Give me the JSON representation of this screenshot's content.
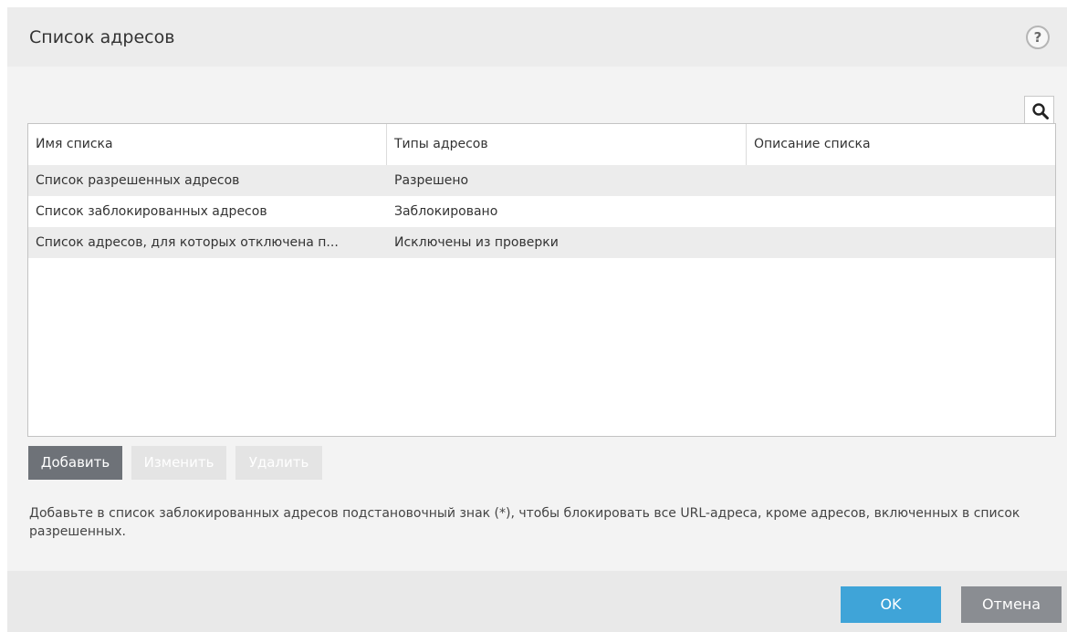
{
  "dialog": {
    "title": "Список адресов",
    "help_symbol": "?"
  },
  "table": {
    "columns": [
      "Имя списка",
      "Типы адресов",
      "Описание списка"
    ],
    "rows": [
      {
        "name": "Список разрешенных адресов",
        "type": "Разрешено",
        "description": ""
      },
      {
        "name": "Список заблокированных адресов",
        "type": "Заблокировано",
        "description": ""
      },
      {
        "name": "Список адресов, для которых отключена п...",
        "type": "Исключены из проверки",
        "description": ""
      }
    ]
  },
  "actions": {
    "add_label": "Добавить",
    "edit_label": "Изменить",
    "delete_label": "Удалить"
  },
  "hint_text": "Добавьте в список заблокированных адресов подстановочный знак (*), чтобы блокировать все URL-адреса, кроме адресов, включенных в список разрешенных.",
  "footer": {
    "ok_label": "OK",
    "cancel_label": "Отмена"
  },
  "colors": {
    "ok_accent": "#3fa4d8",
    "add_button": "#6e7278",
    "cancel_button": "#8a8d92"
  },
  "icons": {
    "help": "question-mark-icon",
    "search": "search-icon"
  }
}
